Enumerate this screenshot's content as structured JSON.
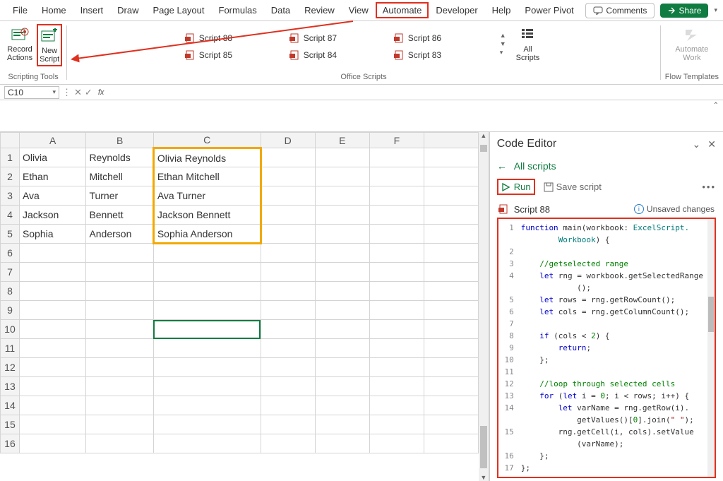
{
  "ribbon": {
    "tabs": [
      "File",
      "Home",
      "Insert",
      "Draw",
      "Page Layout",
      "Formulas",
      "Data",
      "Review",
      "View",
      "Automate",
      "Developer",
      "Help",
      "Power Pivot"
    ],
    "active_tab_index": 9,
    "comments_label": "Comments",
    "share_label": "Share"
  },
  "toolbar": {
    "record_actions_label1": "Record",
    "record_actions_label2": "Actions",
    "new_script_label1": "New",
    "new_script_label2": "Script",
    "scripting_tools_group": "Scripting Tools",
    "office_scripts_group": "Office Scripts",
    "flow_templates_group": "Flow Templates",
    "all_scripts_label1": "All",
    "all_scripts_label2": "Scripts",
    "automate_work_label1": "Automate",
    "automate_work_label2": "Work",
    "scripts": [
      "Script 88",
      "Script 87",
      "Script 86",
      "Script 85",
      "Script 84",
      "Script 83"
    ]
  },
  "formula_bar": {
    "name_box": "C10",
    "fx": "fx"
  },
  "sheet": {
    "col_headers": [
      "A",
      "B",
      "C",
      "D",
      "E",
      "F"
    ],
    "row_count": 16,
    "cells": {
      "A1": "Olivia",
      "B1": "Reynolds",
      "C1": "Olivia Reynolds",
      "A2": "Ethan",
      "B2": "Mitchell",
      "C2": "Ethan Mitchell",
      "A3": "Ava",
      "B3": "Turner",
      "C3": "Ava Turner",
      "A4": "Jackson",
      "B4": "Bennett",
      "C4": "Jackson Bennett",
      "A5": "Sophia",
      "B5": "Anderson",
      "C5": "Sophia Anderson"
    }
  },
  "editor": {
    "title": "Code Editor",
    "back_label": "All scripts",
    "run_label": "Run",
    "save_label": "Save script",
    "file_name": "Script 88",
    "unsaved_label": "Unsaved changes",
    "code": {
      "1": {
        "tokens": [
          [
            "kw",
            "function"
          ],
          [
            "",
            " main(workbook: "
          ],
          [
            "type",
            "ExcelScript."
          ]
        ]
      },
      "1b": {
        "indent": "        ",
        "tokens": [
          [
            "type",
            "Workbook"
          ],
          [
            "",
            ") {"
          ]
        ]
      },
      "2": {
        "indent": "    ",
        "tokens": []
      },
      "3": {
        "indent": "    ",
        "tokens": [
          [
            "comment",
            "//getselected range"
          ]
        ]
      },
      "4": {
        "indent": "    ",
        "tokens": [
          [
            "kw",
            "let"
          ],
          [
            "",
            " rng = workbook.getSelectedRange"
          ]
        ]
      },
      "4b": {
        "indent": "            ",
        "tokens": [
          [
            "",
            "();"
          ]
        ]
      },
      "5": {
        "indent": "    ",
        "tokens": [
          [
            "kw",
            "let"
          ],
          [
            "",
            " rows = rng.getRowCount();"
          ]
        ]
      },
      "6": {
        "indent": "    ",
        "tokens": [
          [
            "kw",
            "let"
          ],
          [
            "",
            " cols = rng.getColumnCount();"
          ]
        ]
      },
      "7": {
        "indent": "    ",
        "tokens": []
      },
      "8": {
        "indent": "    ",
        "tokens": [
          [
            "kw",
            "if"
          ],
          [
            "",
            " (cols < "
          ],
          [
            "num",
            "2"
          ],
          [
            "",
            ") {"
          ]
        ]
      },
      "9": {
        "indent": "        ",
        "tokens": [
          [
            "kw",
            "return"
          ],
          [
            "",
            ";"
          ]
        ]
      },
      "10": {
        "indent": "    ",
        "tokens": [
          [
            "",
            "};"
          ]
        ]
      },
      "11": {
        "indent": "    ",
        "tokens": []
      },
      "12": {
        "indent": "    ",
        "tokens": [
          [
            "comment",
            "//loop through selected cells"
          ]
        ]
      },
      "13": {
        "indent": "    ",
        "tokens": [
          [
            "kw",
            "for"
          ],
          [
            "",
            " ("
          ],
          [
            "kw",
            "let"
          ],
          [
            "",
            " i = "
          ],
          [
            "num",
            "0"
          ],
          [
            "",
            "; i < rows; i++) {"
          ]
        ]
      },
      "14": {
        "indent": "        ",
        "tokens": [
          [
            "kw",
            "let"
          ],
          [
            "",
            " varName = rng.getRow(i)."
          ]
        ]
      },
      "14b": {
        "indent": "            ",
        "tokens": [
          [
            "",
            "getValues()["
          ],
          [
            "num",
            "0"
          ],
          [
            "",
            "].join("
          ],
          [
            "str",
            "\" \""
          ],
          [
            "",
            ");"
          ]
        ]
      },
      "15": {
        "indent": "        ",
        "tokens": [
          [
            "",
            "rng.getCell(i, cols).setValue"
          ]
        ]
      },
      "15b": {
        "indent": "            ",
        "tokens": [
          [
            "",
            "(varName);"
          ]
        ]
      },
      "16": {
        "indent": "    ",
        "tokens": [
          [
            "",
            "};"
          ]
        ]
      },
      "17": {
        "indent": "",
        "tokens": [
          [
            "",
            "};"
          ]
        ]
      }
    },
    "line_numbers": [
      1,
      2,
      3,
      4,
      5,
      6,
      7,
      8,
      9,
      10,
      11,
      12,
      13,
      14,
      15,
      16,
      17
    ]
  }
}
